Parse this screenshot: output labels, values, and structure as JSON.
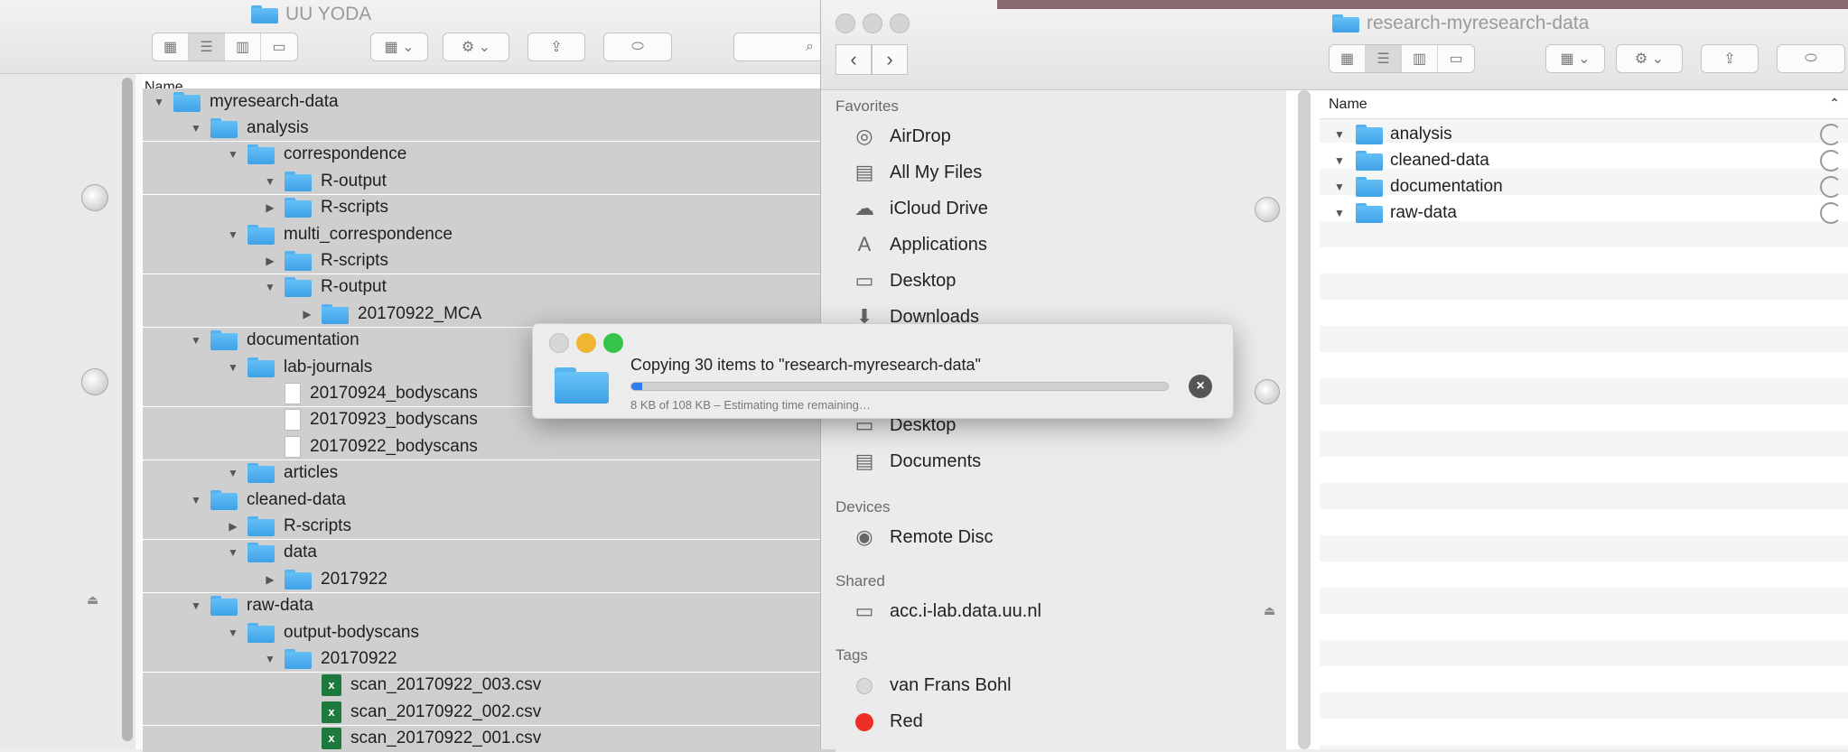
{
  "left_window": {
    "title": "UU YODA",
    "column_header": "Name",
    "rows": [
      {
        "label": "myresearch-data",
        "level": 0,
        "open": true,
        "icon": "folder"
      },
      {
        "label": "analysis",
        "level": 1,
        "open": true,
        "icon": "folder"
      },
      {
        "label": "correspondence",
        "level": 2,
        "open": true,
        "icon": "folder"
      },
      {
        "label": "R-output",
        "level": 3,
        "open": true,
        "icon": "folder"
      },
      {
        "label": "R-scripts",
        "level": 3,
        "open": false,
        "icon": "folder"
      },
      {
        "label": "multi_correspondence",
        "level": 2,
        "open": true,
        "icon": "folder"
      },
      {
        "label": "R-scripts",
        "level": 3,
        "open": false,
        "icon": "folder"
      },
      {
        "label": "R-output",
        "level": 3,
        "open": true,
        "icon": "folder"
      },
      {
        "label": "20170922_MCA",
        "level": 4,
        "open": false,
        "icon": "folder"
      },
      {
        "label": "documentation",
        "level": 1,
        "open": true,
        "icon": "folder"
      },
      {
        "label": "lab-journals",
        "level": 2,
        "open": true,
        "icon": "folder"
      },
      {
        "label": "20170924_bodyscans",
        "level": 3,
        "open": null,
        "icon": "file"
      },
      {
        "label": "20170923_bodyscans",
        "level": 3,
        "open": null,
        "icon": "file"
      },
      {
        "label": "20170922_bodyscans",
        "level": 3,
        "open": null,
        "icon": "file"
      },
      {
        "label": "articles",
        "level": 2,
        "open": true,
        "icon": "folder"
      },
      {
        "label": "cleaned-data",
        "level": 1,
        "open": true,
        "icon": "folder"
      },
      {
        "label": "R-scripts",
        "level": 2,
        "open": false,
        "icon": "folder"
      },
      {
        "label": "data",
        "level": 2,
        "open": true,
        "icon": "folder"
      },
      {
        "label": "2017922",
        "level": 3,
        "open": false,
        "icon": "folder"
      },
      {
        "label": "raw-data",
        "level": 1,
        "open": true,
        "icon": "folder"
      },
      {
        "label": "output-bodyscans",
        "level": 2,
        "open": true,
        "icon": "folder"
      },
      {
        "label": "20170922",
        "level": 3,
        "open": true,
        "icon": "folder"
      },
      {
        "label": "scan_20170922_003.csv",
        "level": 4,
        "open": null,
        "icon": "csv"
      },
      {
        "label": "scan_20170922_002.csv",
        "level": 4,
        "open": null,
        "icon": "csv"
      },
      {
        "label": "scan_20170922_001.csv",
        "level": 4,
        "open": null,
        "icon": "csv"
      }
    ]
  },
  "right_window": {
    "title": "research-myresearch-data",
    "column_header": "Name",
    "sidebar": {
      "favorites_label": "Favorites",
      "favorites": [
        {
          "label": "AirDrop",
          "icon": "airdrop-icon"
        },
        {
          "label": "All My Files",
          "icon": "all-files-icon"
        },
        {
          "label": "iCloud Drive",
          "icon": "cloud-icon"
        },
        {
          "label": "Applications",
          "icon": "applications-icon"
        },
        {
          "label": "Desktop",
          "icon": "desktop-icon"
        },
        {
          "label": "Downloads",
          "icon": "downloads-icon"
        },
        {
          "label": "Desktop",
          "icon": "desktop-icon"
        },
        {
          "label": "Documents",
          "icon": "documents-icon"
        }
      ],
      "devices_label": "Devices",
      "devices": [
        {
          "label": "Remote Disc",
          "icon": "disc-icon"
        }
      ],
      "shared_label": "Shared",
      "shared": [
        {
          "label": "acc.i-lab.data.uu.nl",
          "icon": "server-icon"
        }
      ],
      "tags_label": "Tags",
      "tags": [
        {
          "label": "van Frans Bohl",
          "color": "#d8d8d8"
        },
        {
          "label": "Red",
          "color": "#ee2d24"
        }
      ]
    },
    "rows": [
      "analysis",
      "cleaned-data",
      "documentation",
      "raw-data"
    ]
  },
  "copy_dialog": {
    "title": "Copying 30 items to \"research-myresearch-data\"",
    "subtitle": "8 KB of 108 KB – Estimating time remaining…",
    "progress_fraction": 0.02,
    "cancel_icon": "close-circle-icon"
  },
  "colors": {
    "folder_blue": "#4aaef0",
    "selection_gray": "#cfcfcf",
    "progress_blue": "#2e7ef0",
    "traffic_red": "#ee5a4f",
    "traffic_yellow": "#f1b534",
    "traffic_green": "#34c548"
  }
}
